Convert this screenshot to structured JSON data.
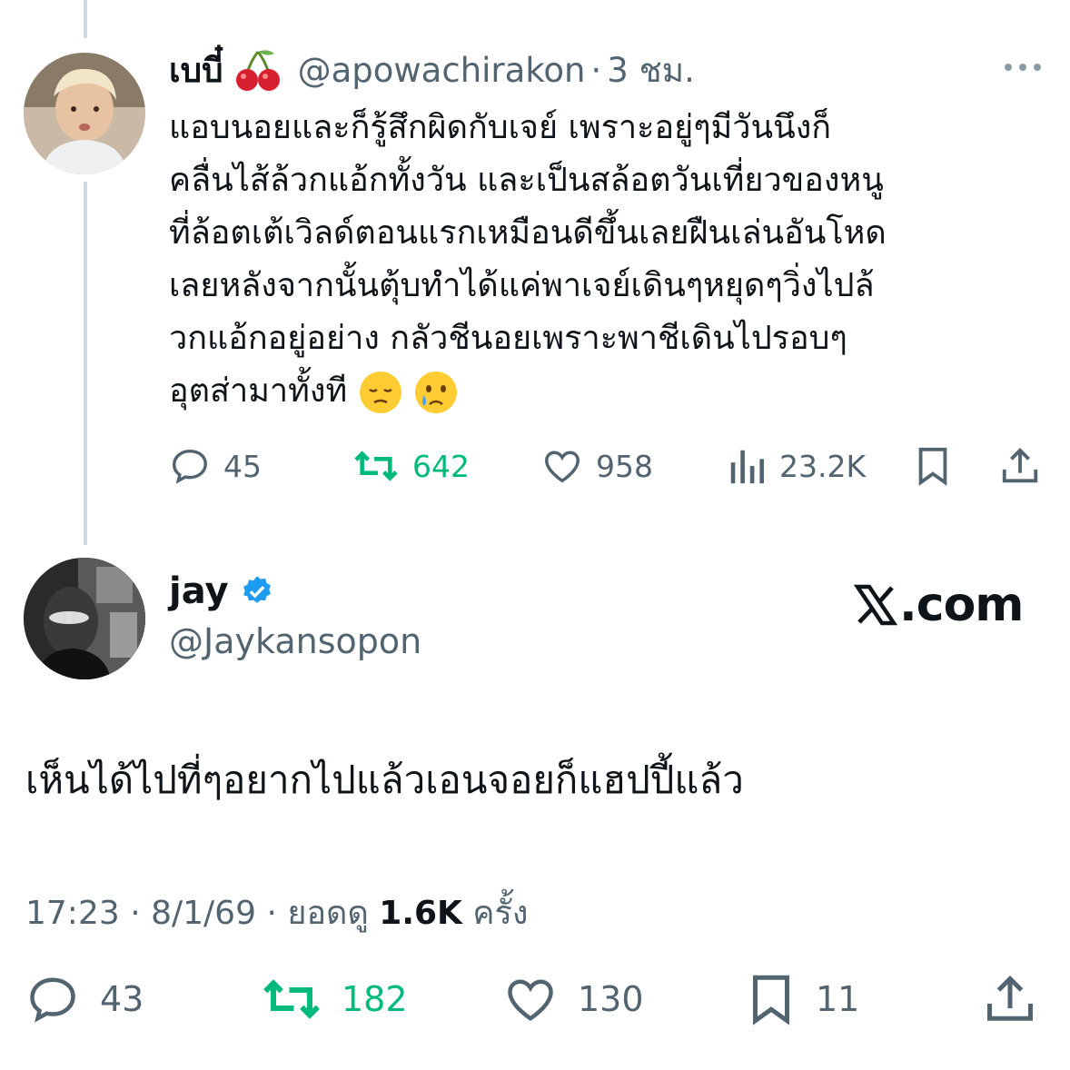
{
  "reply_tweet": {
    "display_name": "เบบี๋",
    "name_emoji_icon": "cherries-emoji",
    "handle": "@apowachirakon",
    "separator": "·",
    "time_ago": "3 ชม.",
    "text_lines": [
      "แอบนอยและก็รู้สึกผิดกับเจย์ เพราะอยู่ๆมีวันนึงก็",
      "คลื่นไส้ล้วกแอ้กทั้งวัน และเป็นสล้อตวันเที่ยวของหนู",
      "ที่ล้อตเต้เวิลด์ตอนแรกเหมือนดีขึ้นเลยฝืนเล่นอันโหด",
      "เลยหลังจากนั้นตุ้บทำได้แค่พาเจย์เดินๆหยุดๆวิ่งไปล้",
      "วกแอ้กอยู่อย่าง กลัวชีนอยเพราะพาชีเดินไปรอบๆ",
      "อุตส่ามาทั้งที"
    ],
    "trailing_emojis": [
      "pensive-face-emoji",
      "crying-face-emoji"
    ],
    "actions": {
      "replies": "45",
      "reposts": "642",
      "likes": "958",
      "views": "23.2K"
    }
  },
  "main_tweet": {
    "display_name": "jay",
    "verified": true,
    "handle": "@Jaykansopon",
    "watermark": ".com",
    "text": "เห็นได้ไปที่ๆอยากไปแล้วเอนจอยก็แฮปปี้แล้ว",
    "meta": {
      "time": "17:23",
      "sep1": "·",
      "date": "8/1/69",
      "sep2": "·",
      "views_label": "ยอดดู",
      "views_count": "1.6K",
      "views_suffix": "ครั้ง"
    },
    "actions": {
      "replies": "43",
      "reposts": "182",
      "likes": "130",
      "bookmarks": "11"
    }
  },
  "colors": {
    "text": "#0f1419",
    "secondary": "#536471",
    "repost_green": "#00ba7c",
    "verified_blue": "#1d9bf0",
    "thread_line": "#cfd9de"
  }
}
